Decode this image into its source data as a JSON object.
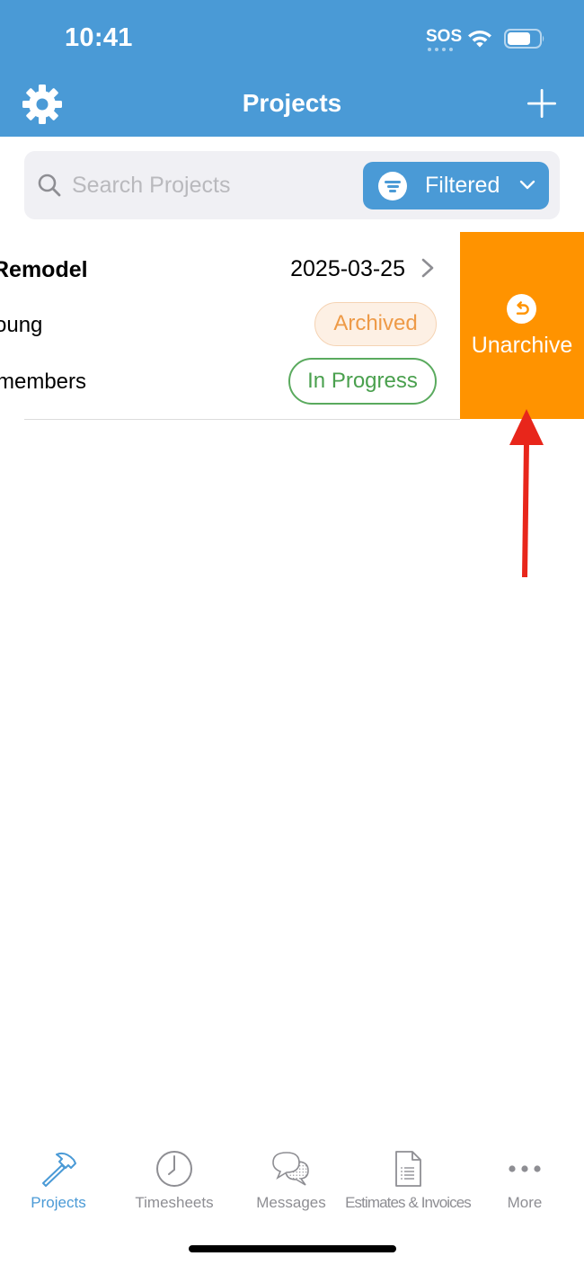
{
  "status_bar": {
    "time": "10:41",
    "carrier": "SOS"
  },
  "nav": {
    "title": "Projects",
    "left_icon": "gear-icon",
    "right_icon": "plus-icon"
  },
  "search": {
    "placeholder": "Search Projects",
    "value": "",
    "filter_label": "Filtered"
  },
  "project_row": {
    "title": "Remodel",
    "date": "2025-03-25",
    "client": "oung",
    "members": "members",
    "archived_badge": "Archived",
    "status_badge": "In Progress"
  },
  "swipe_action": {
    "label": "Unarchive",
    "icon": "undo-icon",
    "color": "#ff9300"
  },
  "tab_bar": {
    "tabs": [
      {
        "label": "Projects",
        "icon": "hammer-icon",
        "active": true
      },
      {
        "label": "Timesheets",
        "icon": "clock-icon",
        "active": false
      },
      {
        "label": "Messages",
        "icon": "chat-bubbles-icon",
        "active": false
      },
      {
        "label": "Estimates & Invoices",
        "icon": "document-icon",
        "active": false
      },
      {
        "label": "More",
        "icon": "ellipsis-icon",
        "active": false
      }
    ]
  },
  "colors": {
    "brand_blue": "#4a9ad6",
    "archived": "#ee9a47",
    "in_progress": "#4aa04e",
    "annotation_arrow": "#e8261b"
  }
}
